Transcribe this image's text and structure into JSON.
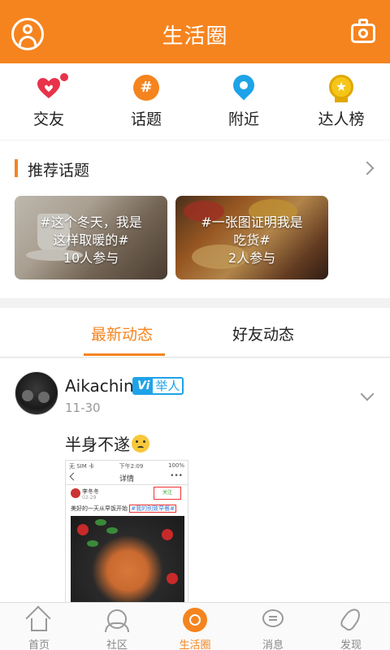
{
  "header": {
    "title": "生活圈",
    "left_icon": "user-icon",
    "right_icon": "camera-icon"
  },
  "quick_entries": [
    {
      "label": "交友",
      "icon": "heart-icon",
      "color": "#e8334a"
    },
    {
      "label": "话题",
      "icon": "hashtag-icon",
      "glyph": "#",
      "color": "#f5841f"
    },
    {
      "label": "附近",
      "icon": "location-pin-icon",
      "color": "#1ea3e8"
    },
    {
      "label": "达人榜",
      "icon": "medal-icon",
      "glyph": "★",
      "color": "#f5c518"
    }
  ],
  "recommended": {
    "title": "推荐话题",
    "cards": [
      {
        "line1": "#这个冬天，我是",
        "line2": "这样取暖的#",
        "line3": "10人参与"
      },
      {
        "line1": "#一张图证明我是",
        "line2": "吃货#",
        "line3": "2人参与"
      }
    ]
  },
  "tabs": {
    "latest": "最新动态",
    "friends": "好友动态"
  },
  "post": {
    "username": "Aikachin",
    "badge_v": "Vi",
    "badge_text": "举人",
    "date": "11-30",
    "text": "半身不遂",
    "screenshot": {
      "status_left": "无 SIM 卡",
      "status_time": "下午2:09",
      "status_battery": "100%",
      "nav_title": "详情",
      "nav_menu": "•••",
      "user": "李冬冬",
      "time": "02-29",
      "follow": "关注",
      "text": "美好的一天从早饭开始",
      "tag": "#我的别致早餐#"
    }
  },
  "bottom_nav": [
    {
      "label": "首页",
      "icon": "home-icon",
      "active": false
    },
    {
      "label": "社区",
      "icon": "community-icon",
      "active": false
    },
    {
      "label": "生活圈",
      "icon": "life-circle-icon",
      "active": true
    },
    {
      "label": "消息",
      "icon": "message-icon",
      "active": false
    },
    {
      "label": "发现",
      "icon": "rocket-icon",
      "active": false
    }
  ],
  "colors": {
    "accent": "#f5841f",
    "verified": "#1ea3e8"
  }
}
